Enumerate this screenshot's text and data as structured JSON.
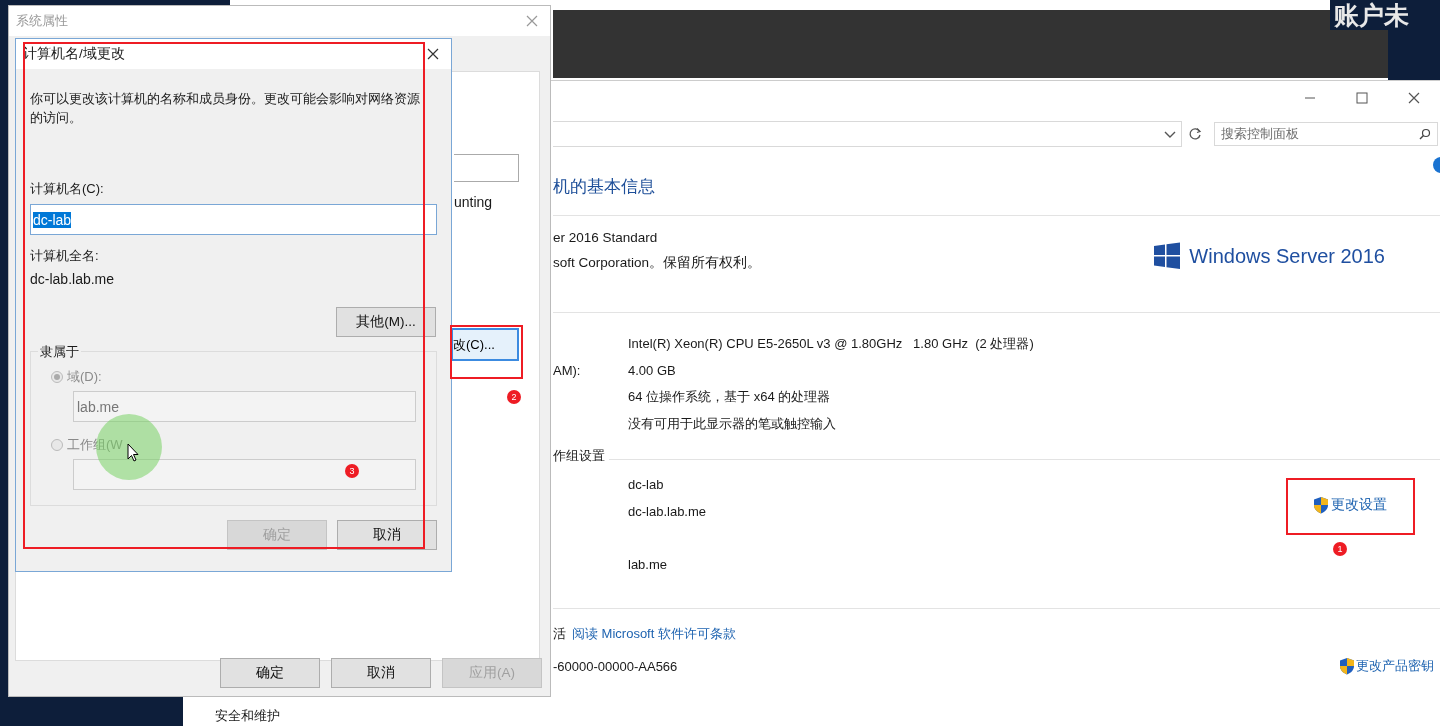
{
  "desktop": {
    "banner_text": "账户未"
  },
  "control_panel": {
    "search": {
      "placeholder": "搜索控制面板"
    },
    "heading": "机的基本信息",
    "edition_lines": [
      "er 2016 Standard",
      "soft Corporation。保留所有权利。"
    ],
    "logo_text": "Windows Server 2016",
    "specs": [
      {
        "value": "Intel(R) Xeon(R) CPU E5-2650L v3 @ 1.80GHz   1.80 GHz  (2 处理器)"
      },
      {
        "label": "AM):",
        "value": "4.00 GB"
      },
      {
        "value": "64 位操作系统，基于 x64 的处理器"
      },
      {
        "value": "没有可用于此显示器的笔或触控输入"
      }
    ],
    "name_section_title": "作组设置",
    "name_rows": [
      {
        "value": "dc-lab"
      },
      {
        "value": "dc-lab.lab.me"
      }
    ],
    "domain": "lab.me",
    "change_settings_link": "更改设置",
    "license_prefix": "活",
    "license_link": "阅读 Microsoft 软件许可条款",
    "product_id": "-60000-00000-AA566",
    "change_key_link": "更改产品密钥",
    "left_pane_item": "安全和维护"
  },
  "system_properties": {
    "title": "系统属性",
    "partial_text": "unting",
    "change_button": "改(C)...",
    "buttons": [
      {
        "label": "确定",
        "disabled": false
      },
      {
        "label": "取消",
        "disabled": false
      },
      {
        "label": "应用(A)",
        "disabled": true
      }
    ]
  },
  "name_dialog": {
    "title": "计算机名/域更改",
    "description": "你可以更改该计算机的名称和成员身份。更改可能会影响对网络资源的访问。",
    "computer_name": {
      "label": "计算机名(C):",
      "value": "dc-lab",
      "value_selected": true
    },
    "full_name": {
      "label": "计算机全名:",
      "value": "dc-lab.lab.me"
    },
    "more_button": "其他(M)...",
    "member_of": {
      "title": "隶属于",
      "options": [
        {
          "label": "域(D):",
          "selected": true,
          "disabled": true,
          "value": "lab.me"
        },
        {
          "label": "工作组(W",
          "selected": false,
          "disabled": true
        }
      ]
    },
    "buttons": [
      {
        "label": "确定",
        "disabled": true
      },
      {
        "label": "取消",
        "disabled": false
      }
    ]
  },
  "annotations": [
    {
      "number": "1"
    },
    {
      "number": "2"
    },
    {
      "number": "3"
    }
  ]
}
